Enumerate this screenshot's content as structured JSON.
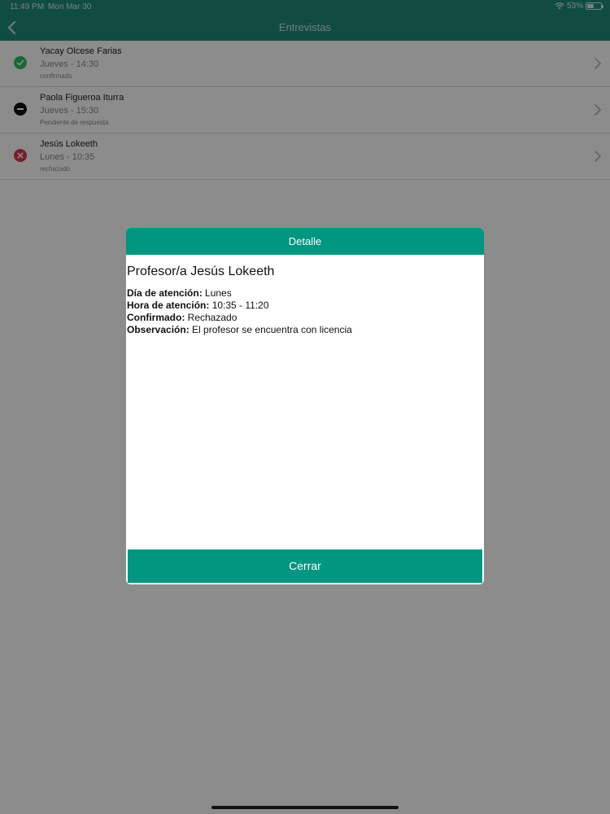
{
  "status_bar": {
    "time": "11:49 PM",
    "date": "Mon Mar 30",
    "battery": "53%",
    "battery_level": 0.53
  },
  "nav": {
    "title": "Entrevistas",
    "back_icon": "chevron-left-icon"
  },
  "colors": {
    "accent": "#009680",
    "confirmed": "#2dbf62",
    "pending": "#111111",
    "rejected": "#d83a4f"
  },
  "interviews": [
    {
      "name": "Yacay Olcese Farias",
      "time": "Jueves - 14:30",
      "status": "confirmado",
      "icon": "check-circle-icon"
    },
    {
      "name": "Paola Figueroa Iturra",
      "time": "Jueves - 15:30",
      "status": "Pendiente de respuesta",
      "icon": "minus-circle-icon"
    },
    {
      "name": "Jesús Lokeeth",
      "time": "Lunes - 10:35",
      "status": "rechazado",
      "icon": "x-circle-icon"
    }
  ],
  "modal": {
    "header": "Detalle",
    "title": "Profesor/a Jesús Lokeeth",
    "details": [
      {
        "label": "Día de atención:",
        "value": " Lunes"
      },
      {
        "label": "Hora de atención:",
        "value": " 10:35 - 11:20"
      },
      {
        "label": "Confirmado:",
        "value": " Rechazado"
      },
      {
        "label": "Observación:",
        "value": " El profesor se encuentra con licencia"
      }
    ],
    "close_label": "Cerrar"
  }
}
